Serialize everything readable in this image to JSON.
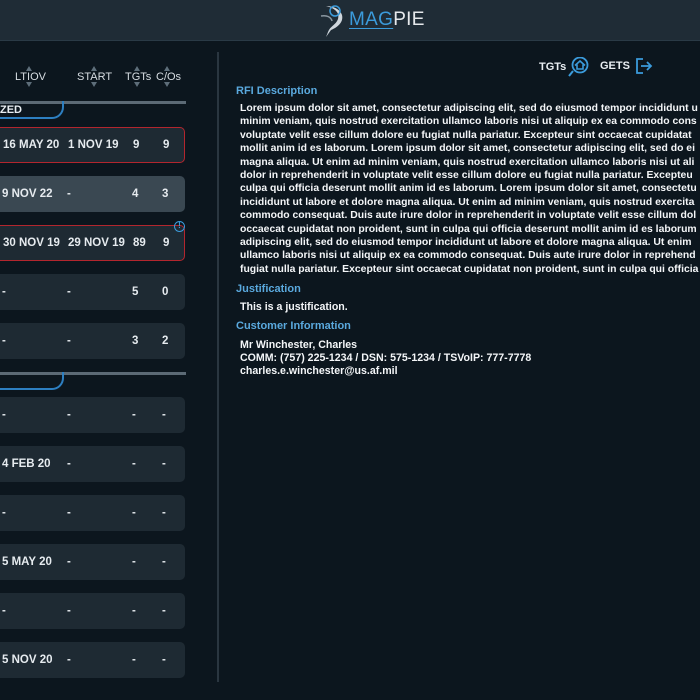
{
  "app": {
    "logo_mag": "MAG",
    "logo_pie": "PIE"
  },
  "columns": {
    "ltiov": "LTIOV",
    "start": "START",
    "tgts": "TGTs",
    "cos": "C/Os"
  },
  "sections": [
    {
      "label": "ZED"
    },
    {
      "label": ""
    }
  ],
  "rows_top": [
    {
      "ltiov": "16 MAY 20",
      "start": "1 NOV 19",
      "tgts": "9",
      "cos": "9",
      "state": "highlight"
    },
    {
      "ltiov": "9 NOV 22",
      "start": "-",
      "tgts": "4",
      "cos": "3",
      "state": "selected"
    },
    {
      "ltiov": "30 NOV 19",
      "start": "29 NOV 19",
      "tgts": "89",
      "cos": "9",
      "state": "highlight"
    },
    {
      "ltiov": "-",
      "start": "-",
      "tgts": "5",
      "cos": "0",
      "state": "normal"
    },
    {
      "ltiov": "-",
      "start": "-",
      "tgts": "3",
      "cos": "2",
      "state": "normal"
    }
  ],
  "rows_bottom": [
    {
      "ltiov": "-",
      "start": "-",
      "tgts": "-",
      "cos": "-"
    },
    {
      "ltiov": "4 FEB 20",
      "start": "-",
      "tgts": "-",
      "cos": "-"
    },
    {
      "ltiov": "-",
      "start": "-",
      "tgts": "-",
      "cos": "-"
    },
    {
      "ltiov": "5 MAY 20",
      "start": "-",
      "tgts": "-",
      "cos": "-"
    },
    {
      "ltiov": "-",
      "start": "-",
      "tgts": "-",
      "cos": "-"
    },
    {
      "ltiov": "5 NOV 20",
      "start": "-",
      "tgts": "-",
      "cos": "-"
    }
  ],
  "nav": {
    "tgts": "TGTs",
    "gets": "GETS"
  },
  "rfi": {
    "description_title": "RFI Description",
    "description_lines": [
      "Lorem ipsum dolor sit amet, consectetur adipiscing elit, sed do eiusmod tempor incididunt u",
      "minim veniam, quis nostrud exercitation ullamco laboris nisi ut aliquip ex ea commodo cons",
      "voluptate velit esse cillum dolore eu fugiat nulla pariatur. Excepteur sint occaecat cupidatat",
      "mollit anim id es laborum. Lorem ipsum dolor sit amet, consectetur adipiscing elit, sed do ei",
      "magna aliqua. Ut enim ad minim veniam, quis nostrud exercitation ullamco laboris nisi ut ali",
      "dolor in reprehenderit in voluptate velit esse cillum dolore eu fugiat nulla pariatur. Excepteu",
      "culpa qui officia deserunt mollit anim id es laborum. Lorem ipsum dolor sit amet, consectetu",
      "incididunt ut labore et dolore magna aliqua. Ut enim ad minim veniam, quis nostrud exercita",
      "commodo consequat. Duis aute irure dolor in reprehenderit in voluptate velit esse cillum dol",
      "occaecat cupidatat non proident, sunt in culpa qui officia deserunt mollit anim id es laborum",
      "adipiscing elit, sed do eiusmod tempor incididunt ut labore et dolore magna aliqua. Ut enim",
      "ullamco laboris nisi ut aliquip ex ea commodo consequat. Duis aute irure dolor in reprehend",
      "fugiat nulla pariatur. Excepteur sint occaecat cupidatat non proident, sunt in culpa qui officia"
    ],
    "justification_title": "Justification",
    "justification": "This is a justification.",
    "customer_title": "Customer Information",
    "customer_name": "Mr Winchester, Charles",
    "customer_comm": "COMM: (757) 225-1234 / DSN: 575-1234 / TSVoIP: 777-7778",
    "customer_email": "charles.e.winchester@us.af.mil"
  },
  "colors": {
    "accent": "#3b9bdb",
    "alert": "#b3262e",
    "background": "#0c161e"
  }
}
